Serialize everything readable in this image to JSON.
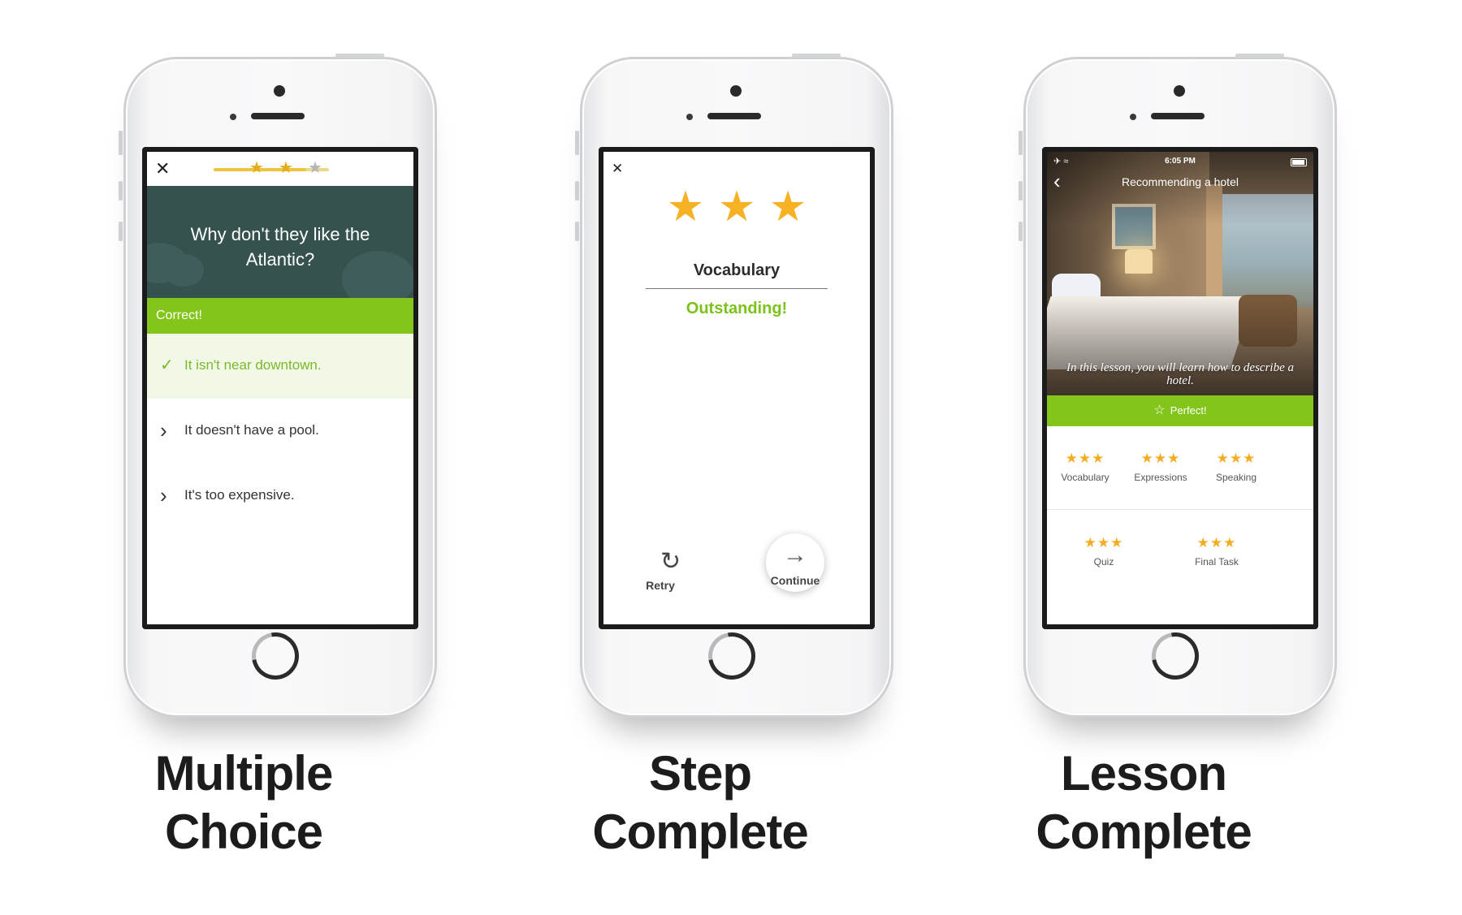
{
  "colors": {
    "accent_green": "#83c51b",
    "star_gold": "#f6b224",
    "question_bg": "#35524f"
  },
  "screens": [
    {
      "caption": [
        "Multiple",
        "Choice"
      ],
      "close_icon": "close-icon",
      "close_glyph": "✕",
      "progress": {
        "completed_stars": 2,
        "total_stars": 3,
        "fraction": 0.8
      },
      "question": "Why don't they like the Atlantic?",
      "feedback": "Correct!",
      "answers": [
        {
          "text": "It isn't near downtown.",
          "icon": "check-icon",
          "glyph": "✓",
          "selected": true
        },
        {
          "text": "It doesn't have a pool.",
          "icon": "chevron-right-icon",
          "glyph": "›",
          "selected": false
        },
        {
          "text": "It's too expensive.",
          "icon": "chevron-right-icon",
          "glyph": "›",
          "selected": false
        }
      ]
    },
    {
      "caption": [
        "Step",
        "Complete"
      ],
      "close_icon": "close-icon",
      "close_glyph": "✕",
      "stars_earned": 3,
      "step_name": "Vocabulary",
      "result": "Outstanding!",
      "retry": {
        "label": "Retry",
        "icon": "retry-icon",
        "glyph": "↻"
      },
      "continue": {
        "label": "Continue",
        "icon": "arrow-right-icon",
        "glyph": "→"
      }
    },
    {
      "caption": [
        "Lesson",
        "Complete"
      ],
      "status_time": "6:05 PM",
      "lesson_title": "Recommending a hotel",
      "lesson_description": "In this lesson, you will learn how to describe a hotel.",
      "perfect_label": "Perfect!",
      "skills": [
        {
          "label": "Vocabulary",
          "stars": 3
        },
        {
          "label": "Expressions",
          "stars": 3
        },
        {
          "label": "Speaking",
          "stars": 3
        },
        {
          "label": "Quiz",
          "stars": 3
        },
        {
          "label": "Final Task",
          "stars": 3
        }
      ]
    }
  ]
}
